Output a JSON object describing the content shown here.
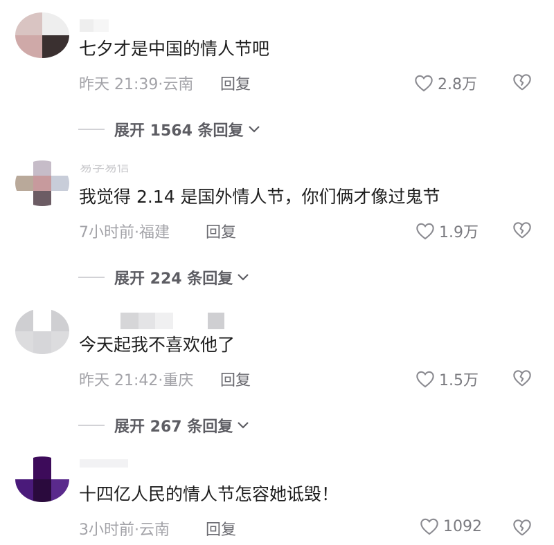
{
  "comments": [
    {
      "text": "七夕才是中国的情人节吧",
      "time_location": "昨天 21:39·云南",
      "reply_label": "回复",
      "likes": "2.8万",
      "expand_label": "展开 1564 条回复"
    },
    {
      "username": "易学易信",
      "text": "我觉得 2.14 是国外情人节，你们俩才像过鬼节",
      "time_location": "7小时前·福建",
      "reply_label": "回复",
      "likes": "1.9万",
      "expand_label": "展开 224 条回复"
    },
    {
      "text": "今天起我不喜欢他了",
      "time_location": "昨天 21:42·重庆",
      "reply_label": "回复",
      "likes": "1.5万",
      "expand_label": "展开 267 条回复"
    },
    {
      "text": "十四亿人民的情人节怎容她诋毁！",
      "time_location": "3小时前·云南",
      "reply_label": "回复",
      "likes": "1092"
    }
  ],
  "colors": {
    "text": "#1d1d1d",
    "meta": "#a3a3a8",
    "reply": "#6a6a70",
    "icon": "#8a8a90"
  },
  "icons": {
    "like": "heart-outline-icon",
    "dislike": "broken-heart-icon",
    "expand": "chevron-down-icon"
  }
}
